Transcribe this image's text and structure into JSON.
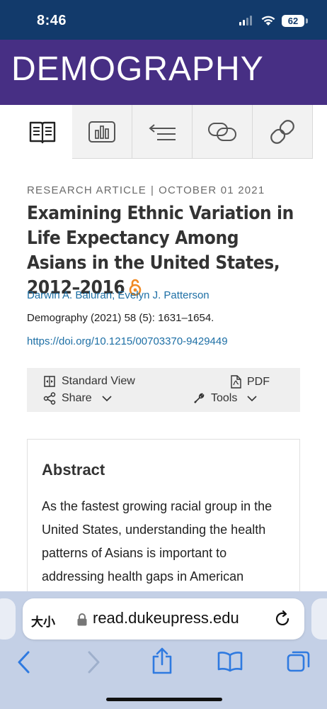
{
  "status_bar": {
    "time": "8:46",
    "battery": "62"
  },
  "banner": {
    "journal_name": "DEMOGRAPHY"
  },
  "tabs": [
    {
      "icon": "book-icon"
    },
    {
      "icon": "bar-chart-icon"
    },
    {
      "icon": "reference-list-icon"
    },
    {
      "icon": "linked-rings-icon"
    },
    {
      "icon": "chain-link-icon"
    }
  ],
  "article": {
    "type": "RESEARCH ARTICLE",
    "separator": "|",
    "date": "OCTOBER 01 2021",
    "title": "Examining Ethnic Variation in Life Expectancy Among Asians in the United States, 2012–2016",
    "authors": [
      "Darwin A. Baluran",
      "Evelyn J. Patterson"
    ],
    "author_separator": ";",
    "citation": "Demography (2021) 58 (5): 1631–1654.",
    "doi": "https://doi.org/10.1215/00703370-9429449"
  },
  "toolbar": {
    "standard_view": "Standard View",
    "pdf": "PDF",
    "share": "Share",
    "tools": "Tools"
  },
  "abstract": {
    "heading": "Abstract",
    "text": "As the fastest growing racial group in the United States, understanding the health patterns of Asians is important to addressing health gaps in American"
  },
  "browser": {
    "text_size_label": "大小",
    "url": "read.dukeupress.edu"
  },
  "colors": {
    "status_bar": "#123a6b",
    "banner": "#472f84",
    "link": "#1d6fa5",
    "open_access": "#f08a24",
    "safari_blue": "#2f7ae0",
    "safari_bar": "#c4d0e6"
  }
}
